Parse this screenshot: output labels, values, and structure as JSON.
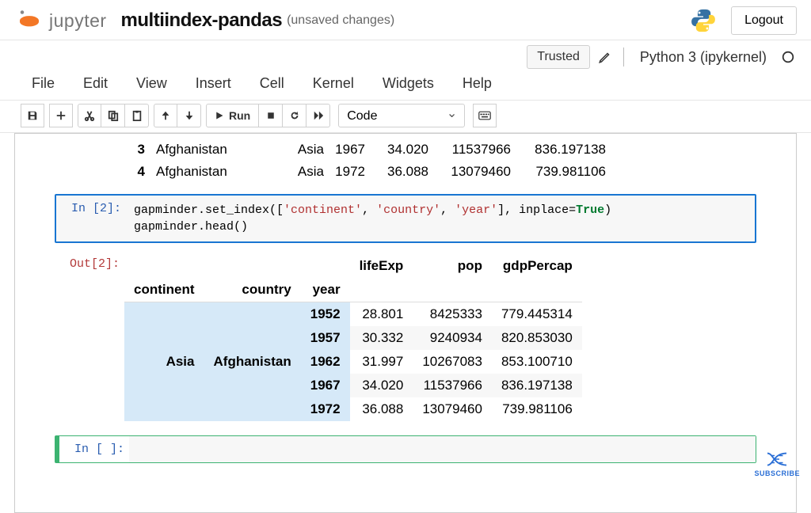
{
  "header": {
    "brand": "jupyter",
    "title": "multiindex-pandas",
    "unsaved": "(unsaved changes)",
    "logout": "Logout"
  },
  "status": {
    "trusted": "Trusted",
    "kernel": "Python 3 (ipykernel)"
  },
  "menu": {
    "file": "File",
    "edit": "Edit",
    "view": "View",
    "insert": "Insert",
    "cell": "Cell",
    "kernel": "Kernel",
    "widgets": "Widgets",
    "help": "Help"
  },
  "toolbar": {
    "run": "Run",
    "cell_type": "Code"
  },
  "peek": {
    "rows": [
      {
        "idx": "3",
        "country": "Afghanistan",
        "continent": "Asia",
        "year": "1967",
        "lifeExp": "34.020",
        "pop": "11537966",
        "gdp": "836.197138"
      },
      {
        "idx": "4",
        "country": "Afghanistan",
        "continent": "Asia",
        "year": "1972",
        "lifeExp": "36.088",
        "pop": "13079460",
        "gdp": "739.981106"
      }
    ]
  },
  "cell_in": {
    "prompt": "In [2]:",
    "line1_pre": "gapminder.set_index([",
    "line1_s1": "'continent'",
    "line1_c1": ", ",
    "line1_s2": "'country'",
    "line1_c2": ", ",
    "line1_s3": "'year'",
    "line1_mid": "], inplace=",
    "line1_kw": "True",
    "line1_end": ")",
    "line2": "gapminder.head()"
  },
  "cell_out": {
    "prompt": "Out[2]:",
    "cols": {
      "lifeExp": "lifeExp",
      "pop": "pop",
      "gdp": "gdpPercap"
    },
    "idxnames": {
      "continent": "continent",
      "country": "country",
      "year": "year"
    },
    "continent": "Asia",
    "country": "Afghanistan",
    "rows": [
      {
        "year": "1952",
        "lifeExp": "28.801",
        "pop": "8425333",
        "gdp": "779.445314"
      },
      {
        "year": "1957",
        "lifeExp": "30.332",
        "pop": "9240934",
        "gdp": "820.853030"
      },
      {
        "year": "1962",
        "lifeExp": "31.997",
        "pop": "10267083",
        "gdp": "853.100710"
      },
      {
        "year": "1967",
        "lifeExp": "34.020",
        "pop": "11537966",
        "gdp": "836.197138"
      },
      {
        "year": "1972",
        "lifeExp": "36.088",
        "pop": "13079460",
        "gdp": "739.981106"
      }
    ]
  },
  "empty_cell": {
    "prompt": "In [ ]:"
  },
  "subscribe": "SUBSCRIBE"
}
